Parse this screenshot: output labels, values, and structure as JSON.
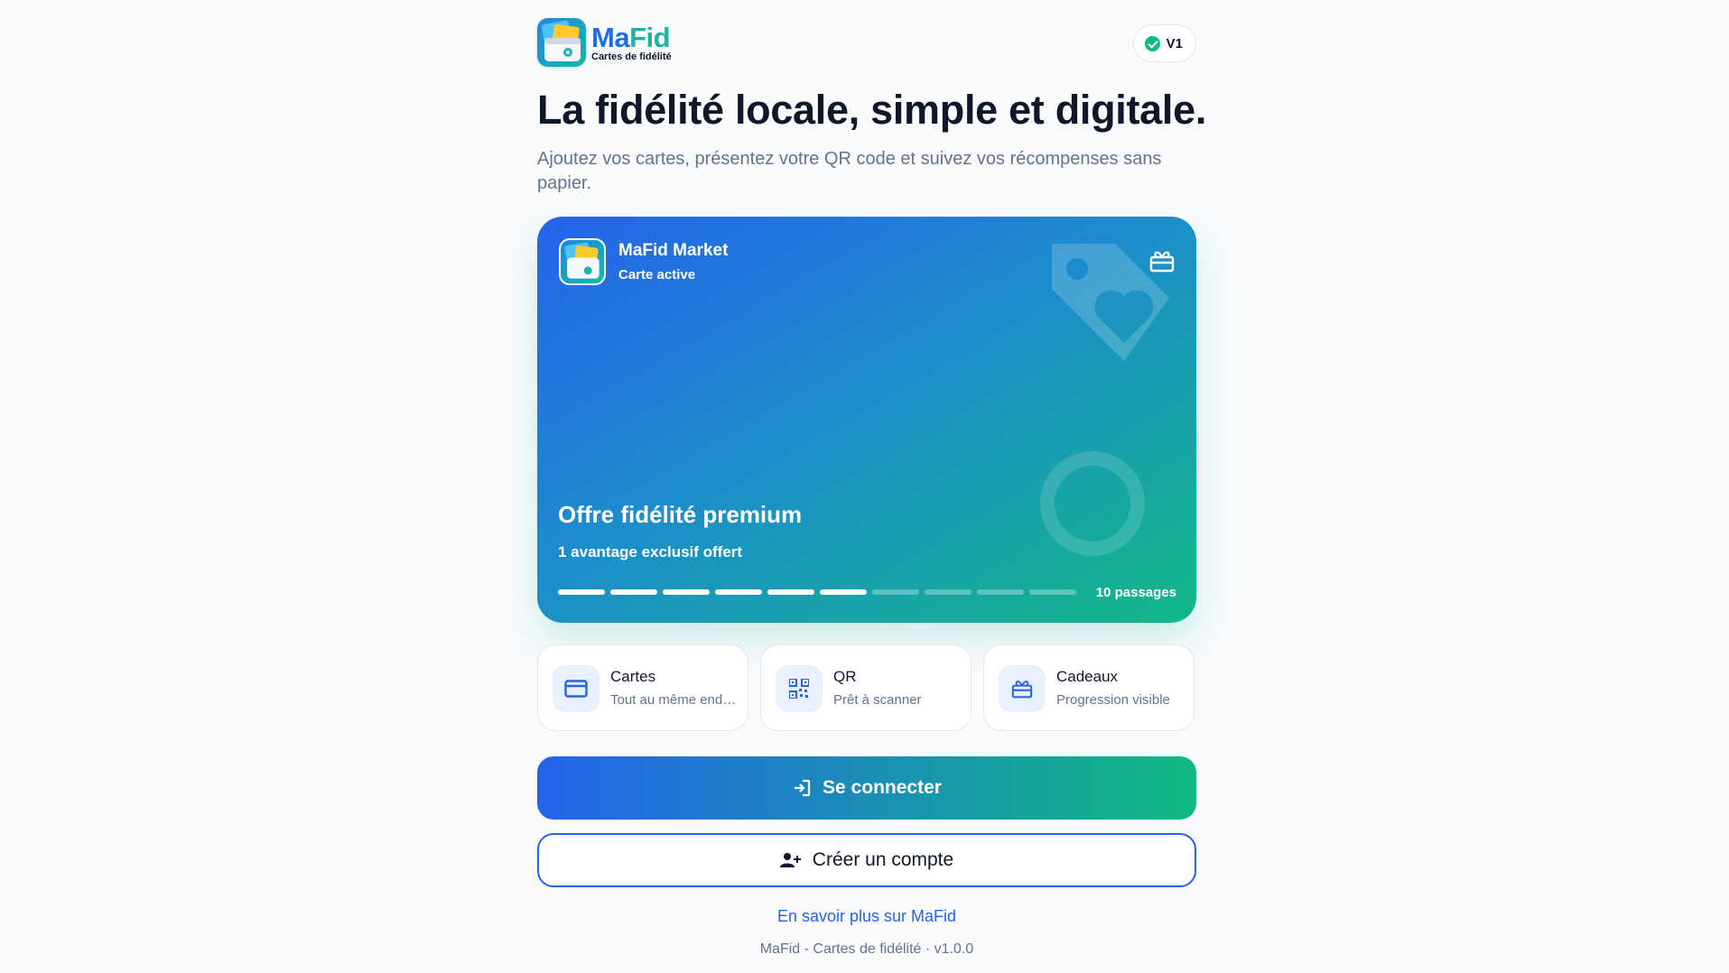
{
  "brand": {
    "name_prefix": "Ma",
    "name_suffix": "Fid",
    "tagline": "Cartes de fidélité"
  },
  "version_badge": "V1",
  "hero": {
    "title": "La fidélité locale, simple et digitale.",
    "subtitle": "Ajoutez vos cartes, présentez votre QR code et suivez vos récompenses sans papier."
  },
  "card": {
    "merchant": "MaFid Market",
    "status": "Carte active",
    "offer_title": "Offre fidélité premium",
    "offer_sub": "1 avantage exclusif offert",
    "passes_label": "10 passages",
    "progress": {
      "filled": 6,
      "total": 10
    },
    "icon": "gift-icon"
  },
  "features": [
    {
      "title": "Cartes",
      "desc": "Tout au même endroit",
      "icon": "credit-card-icon"
    },
    {
      "title": "QR",
      "desc": "Prêt à scanner",
      "icon": "qr-code-icon"
    },
    {
      "title": "Cadeaux",
      "desc": "Progression visible",
      "icon": "gift-icon"
    }
  ],
  "actions": {
    "login": "Se connecter",
    "register": "Créer un compte",
    "learn_more": "En savoir plus sur MaFid"
  },
  "footer": "MaFid - Cartes de fidélité · v1.0.0",
  "colors": {
    "primary": "#2563eb",
    "accent": "#10b981",
    "text": "#0f172a",
    "muted": "#64748b"
  }
}
